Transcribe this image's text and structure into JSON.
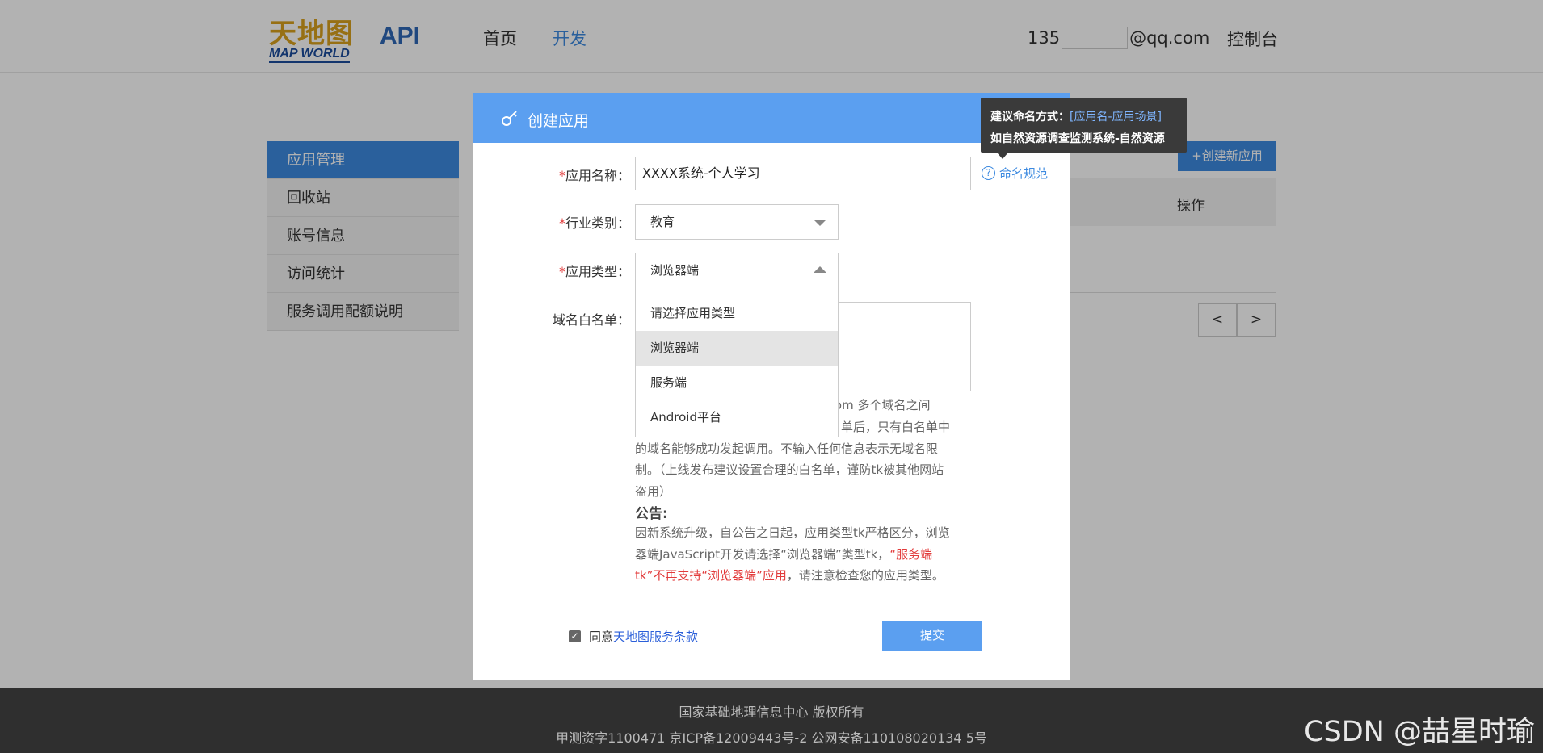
{
  "header": {
    "logo_cn": "天地图",
    "logo_en": "MAP WORLD",
    "api_label": "API",
    "nav": [
      "首页",
      "开发"
    ],
    "email_prefix": "135",
    "email_suffix": "@qq.com",
    "console": "控制台"
  },
  "sidebar": {
    "items": [
      "应用管理",
      "回收站",
      "账号信息",
      "访问统计",
      "服务调用配额说明"
    ]
  },
  "background_page": {
    "create_button": "+创建新应用",
    "table_op_header": "操作",
    "pager": [
      "<",
      ">"
    ]
  },
  "modal": {
    "title": "创建应用",
    "required_mark": "*",
    "name_label": "应用名称：",
    "name_value": "XXXX系统-个人学习",
    "help_link": "命名规范",
    "help_icon": "?",
    "industry_label": "行业类别：",
    "industry_value": "教育",
    "type_label": "应用类型：",
    "type_value": "浏览器端",
    "type_options": [
      "请选择应用类型",
      "浏览器端",
      "服务端",
      "Android平台"
    ],
    "domain_label": "域名白名单：",
    "desc_prefix": "o.com 多个域名之间",
    "desc_body_tail": "名单后，只有白名单中的域名能够成功发起调用。不输入任何信息表示无域名限制。（上线发布建议设置合理的白名单，谨防tk被其他网站盗用）",
    "notice_title": "公告:",
    "notice_part1": "因新系统升级，自公告之日起，应用类型tk严格区分，浏览器端JavaScript开发请选择“浏览器端”类型tk，",
    "notice_red": "“服务端tk”不再支持“浏览器端”应用",
    "notice_part2": "，请注意检查您的应用类型。",
    "agree_text": "同意",
    "terms_link": "天地图服务条款",
    "submit": "提交"
  },
  "tooltip": {
    "line1_prefix": "建议命名方式：",
    "line1_accent": "[应用名-应用场景]",
    "line2": "如自然资源调查监测系统-自然资源"
  },
  "footer": {
    "line1": "国家基础地理信息中心  版权所有",
    "line2": "甲测资字1100471  京ICP备12009443号-2  公网安备110108020134 5号"
  },
  "watermark": "CSDN @喆星时瑜",
  "colors": {
    "primary": "#5b9ff0",
    "nav_active": "#3d8ae0",
    "required": "#e23b3b",
    "tooltip_bg": "#3a3a3a",
    "footer_bg": "#2f2f2f"
  }
}
